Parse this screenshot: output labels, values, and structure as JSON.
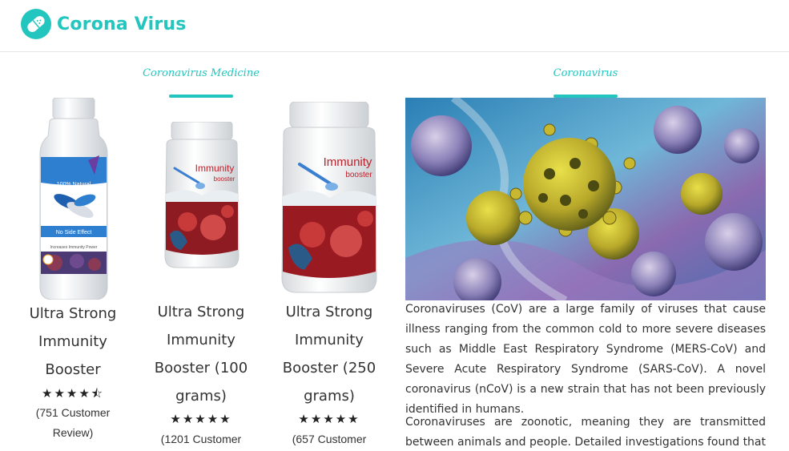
{
  "header": {
    "brand": "Corona Virus",
    "logo_icon": "pill-icon",
    "accent_color": "#22c6bf"
  },
  "sections": {
    "medicine_title": "Coronavirus Medicine",
    "info_title": "Coronavirus"
  },
  "products": [
    {
      "name_lines": [
        "Ultra Strong",
        "Immunity",
        "Booster"
      ],
      "rating": 4.5,
      "stars": "★★★★⯪",
      "review_lines": [
        "(751 Customer",
        "Review)"
      ],
      "label_top": "100% Natural",
      "label_mid": "No Side Effect",
      "label_bottom": "Increases Immunity Power"
    },
    {
      "name_lines": [
        "Ultra Strong",
        "Immunity",
        "Booster (100",
        "grams)"
      ],
      "rating": 5,
      "stars": "★★★★★",
      "review_lines": [
        "(1201 Customer"
      ],
      "label_title": "Immunity",
      "label_sub": "booster"
    },
    {
      "name_lines": [
        "Ultra Strong",
        "Immunity",
        "Booster (250",
        "grams)"
      ],
      "rating": 5,
      "stars": "★★★★★",
      "review_lines": [
        "(657 Customer"
      ],
      "label_title": "Immunity",
      "label_sub": "booster"
    }
  ],
  "article": {
    "p1": "Coronaviruses (CoV) are a large family of viruses that cause illness ranging from the common cold to more severe diseases such as Middle East Respiratory Syndrome (MERS-CoV) and Severe Acute Respiratory Syndrome (SARS-CoV). A novel coronavirus (nCoV) is a new strain that has not been previously identified in humans.",
    "p2": "Coronaviruses are zoonotic, meaning they are transmitted between animals and people. Detailed investigations found that SARS-CoV"
  }
}
